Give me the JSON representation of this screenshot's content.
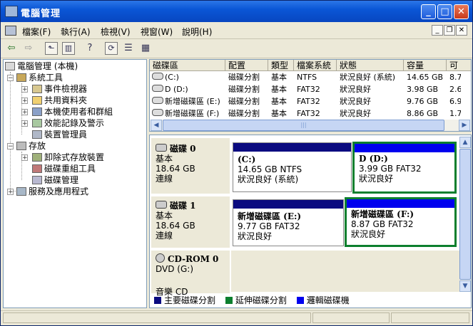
{
  "window": {
    "title": "電腦管理"
  },
  "menu": {
    "items": [
      "檔案(F)",
      "執行(A)",
      "檢視(V)",
      "視窗(W)",
      "說明(H)"
    ]
  },
  "toolbar": {
    "icons": [
      "back-arrow-icon",
      "forward-arrow-icon",
      "up-folder-icon",
      "show-hide-tree-icon",
      "help-icon",
      "refresh-icon",
      "properties-icon",
      "export-icon"
    ]
  },
  "tree": {
    "root": "電腦管理 (本機)",
    "system_tools": "系統工具",
    "event_viewer": "事件檢視器",
    "shared_folders": "共用資料夾",
    "local_users": "本機使用者和群組",
    "perf_logs": "效能記錄及警示",
    "device_manager": "裝置管理員",
    "storage": "存放",
    "removable_storage": "卸除式存放裝置",
    "defrag": "磁碟重組工具",
    "disk_mgmt": "磁碟管理",
    "services_apps": "服務及應用程式"
  },
  "volume_table": {
    "headers": [
      "磁碟區",
      "配置",
      "類型",
      "檔案系統",
      "狀態",
      "容量",
      "可"
    ],
    "rows": [
      [
        "(C:)",
        "磁碟分割",
        "基本",
        "NTFS",
        "狀況良好 (系統)",
        "14.65 GB",
        "8.7"
      ],
      [
        "D (D:)",
        "磁碟分割",
        "基本",
        "FAT32",
        "狀況良好",
        "3.98 GB",
        "2.6"
      ],
      [
        "新增磁碟區 (E:)",
        "磁碟分割",
        "基本",
        "FAT32",
        "狀況良好",
        "9.76 GB",
        "6.9"
      ],
      [
        "新增磁碟區 (F:)",
        "磁碟分割",
        "基本",
        "FAT32",
        "狀況良好",
        "8.86 GB",
        "1.7"
      ]
    ]
  },
  "disks": {
    "disk0": {
      "name": "磁碟 0",
      "type": "基本",
      "size": "18.64 GB",
      "status": "連線",
      "p1": {
        "name": "(C:)",
        "detail": "14.65 GB NTFS",
        "status": "狀況良好 (系統)"
      },
      "p2": {
        "name": "D  (D:)",
        "detail": "3.99 GB FAT32",
        "status": "狀況良好"
      }
    },
    "disk1": {
      "name": "磁碟 1",
      "type": "基本",
      "size": "18.64 GB",
      "status": "連線",
      "p1": {
        "name": "新增磁碟區  (E:)",
        "detail": "9.77 GB FAT32",
        "status": "狀況良好"
      },
      "p2": {
        "name": "新增磁碟區  (F:)",
        "detail": "8.87 GB FAT32",
        "status": "狀況良好"
      }
    },
    "cdrom": {
      "name": "CD-ROM 0",
      "drive": "DVD (G:)",
      "media": "音樂 CD"
    }
  },
  "legend": {
    "primary": "主要磁碟分割",
    "extended": "延伸磁碟分割",
    "logical": "邏輯磁碟機",
    "colors": {
      "primary": "#0b0b80",
      "extended": "#0c7f2e",
      "logical": "#0000ee"
    }
  }
}
